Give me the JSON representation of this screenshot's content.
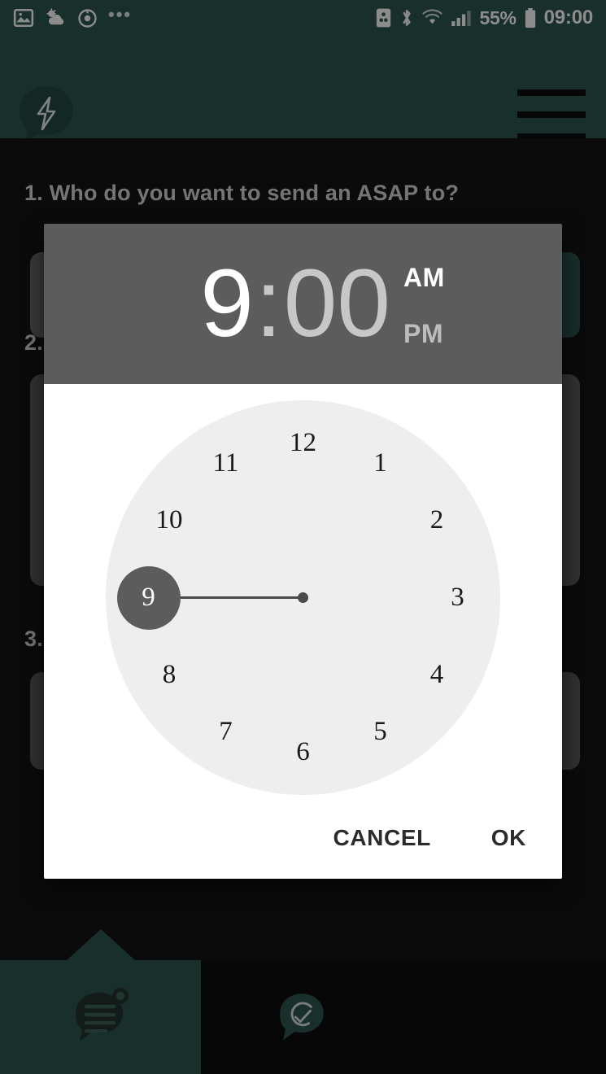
{
  "status_bar": {
    "icons_left": [
      "image-icon",
      "weather-icon",
      "target-icon",
      "more-dots-icon"
    ],
    "icons_right": [
      "nfc-icon",
      "bluetooth-icon",
      "wifi-icon",
      "signal-icon"
    ],
    "battery_percent": "55%",
    "battery_icon": "battery-icon",
    "clock": "09:00"
  },
  "appbar": {
    "logo_icon": "lightning-speech-bubble-logo",
    "menu_icon": "hamburger-menu-icon"
  },
  "form": {
    "questions": [
      {
        "num": "1.",
        "text": "1. Who do you want to send an ASAP to?"
      },
      {
        "num": "2.",
        "text": "2."
      },
      {
        "num": "3.",
        "text": "3."
      }
    ]
  },
  "dialog": {
    "hour": "9",
    "colon": ":",
    "minute": "00",
    "am_label": "AM",
    "pm_label": "PM",
    "selected_meridiem": "AM",
    "selected_unit": "hour",
    "clock_hours": [
      "12",
      "1",
      "2",
      "3",
      "4",
      "5",
      "6",
      "7",
      "8",
      "9",
      "10",
      "11"
    ],
    "selected_hour": "9",
    "cancel_label": "CANCEL",
    "ok_label": "OK"
  },
  "bottom_nav": {
    "tabs": [
      {
        "icon": "message-lines-badge-icon",
        "active": true
      },
      {
        "icon": "clock-check-speech-bubble-icon",
        "active": false
      }
    ]
  },
  "colors": {
    "brand_teal": "#2c5750",
    "page_bg": "#141414",
    "dialog_header": "#5c5c5c",
    "clock_face": "#eeeeee",
    "field_gray": "#6b6b6b",
    "accent_white": "#ffffff"
  }
}
